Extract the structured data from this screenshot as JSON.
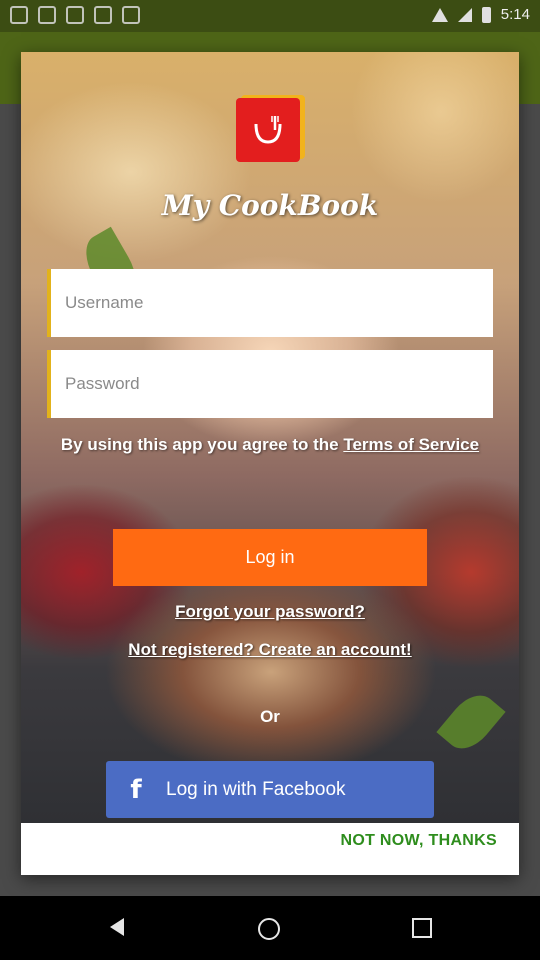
{
  "status_bar": {
    "time": "5:14",
    "icons": [
      "image-icon",
      "game-icon",
      "badge-icon",
      "shield-icon",
      "cloud-icon",
      "wifi-icon",
      "signal-icon",
      "battery-icon"
    ]
  },
  "dialog": {
    "app_name": "My CookBook",
    "username_placeholder": "Username",
    "password_placeholder": "Password",
    "terms_prefix": "By using this app you agree to the ",
    "terms_link": "Terms of Service",
    "login_label": "Log in",
    "forgot_label": "Forgot your password?",
    "register_label": "Not registered? Create an account!",
    "or_label": "Or",
    "facebook_label": "Log in with Facebook",
    "not_now_label": "NOT NOW, THANKS"
  },
  "colors": {
    "accent_orange": "#ff6a12",
    "facebook_blue": "#4b6cc4",
    "logo_red": "#e31e1e",
    "field_marker": "#e2b21b",
    "not_now_green": "#2e8d1d"
  },
  "nav_bar": {
    "icons": [
      "back-icon",
      "home-icon",
      "recents-icon"
    ]
  }
}
